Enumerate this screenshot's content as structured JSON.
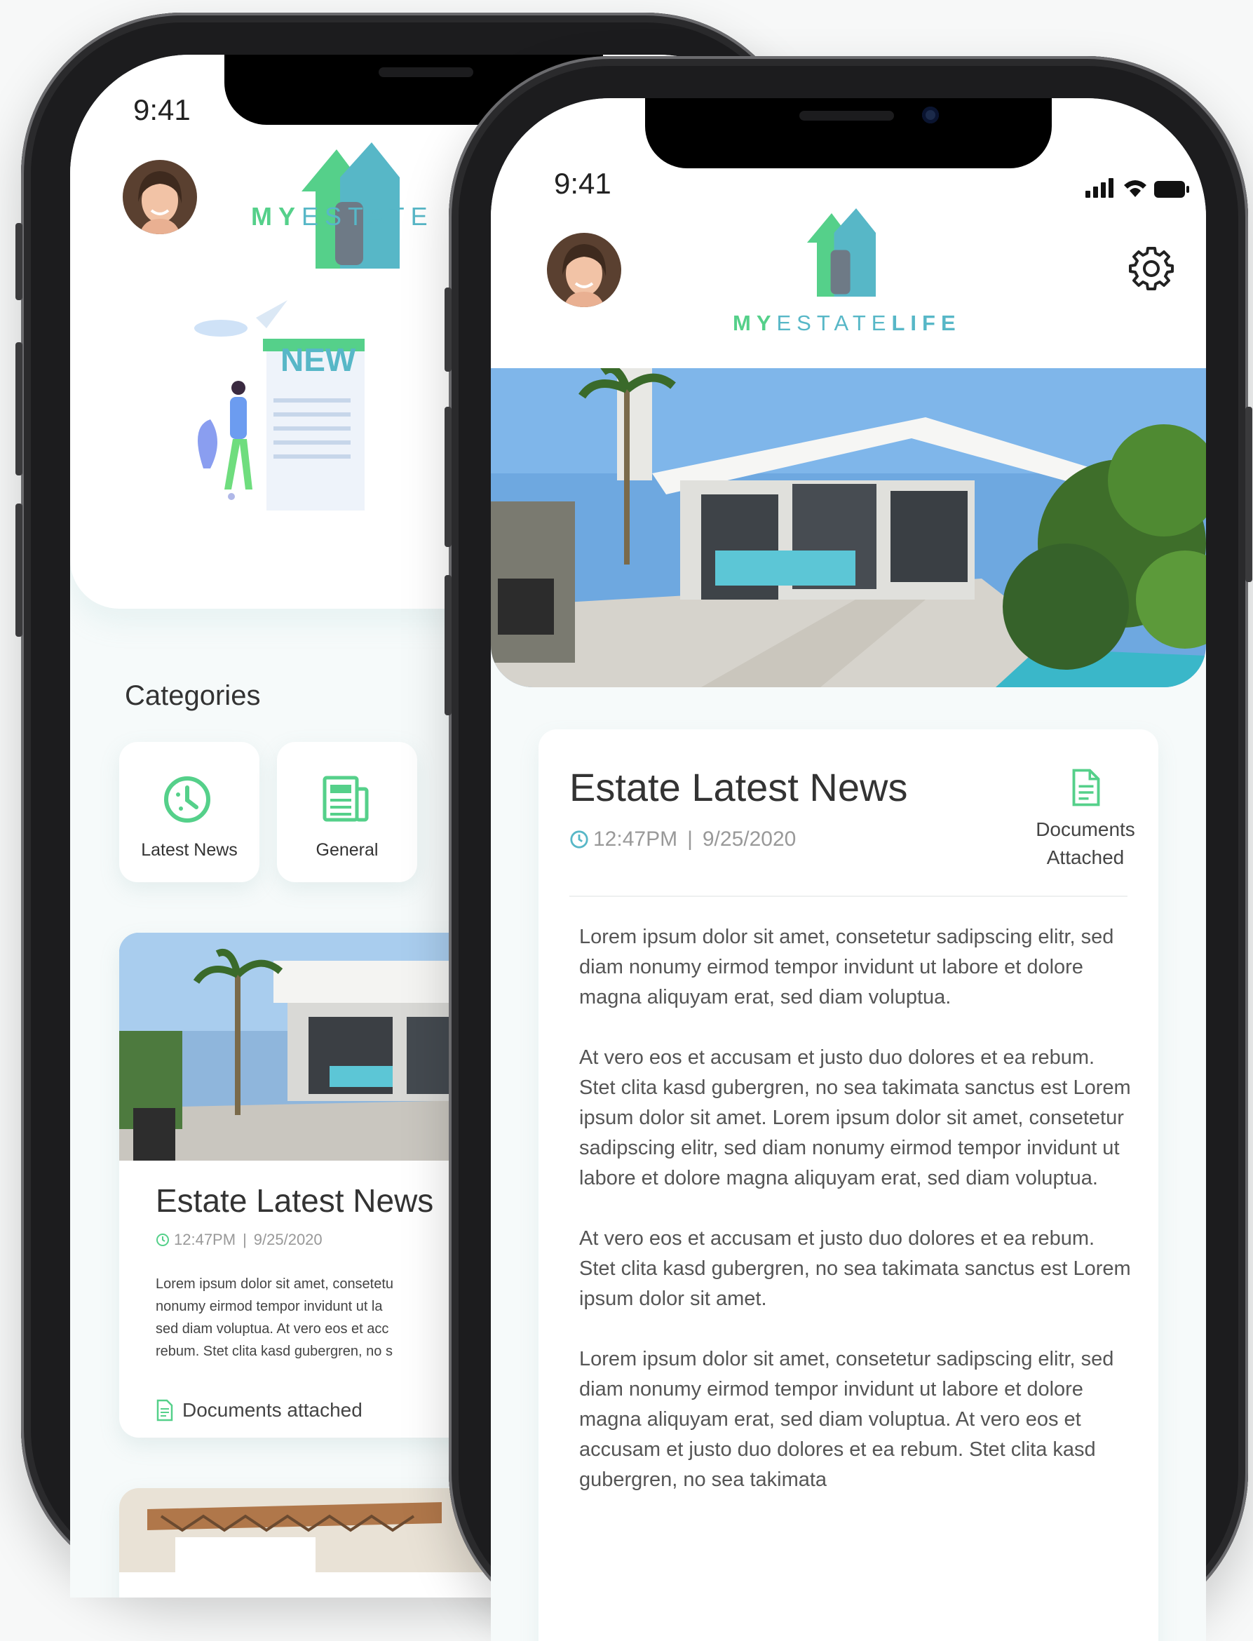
{
  "status_bar": {
    "time": "9:41"
  },
  "brand": {
    "my": "MY",
    "estate": "ESTATE",
    "life": "LIFE"
  },
  "home": {
    "categories_title": "Categories",
    "categories": [
      {
        "label": "Latest News",
        "icon": "clock-icon"
      },
      {
        "label": "General",
        "icon": "newspaper-icon"
      }
    ],
    "illustration_text": "NEW",
    "news_card": {
      "title": "Estate Latest News",
      "time": "12:47PM",
      "date": "9/25/2020",
      "excerpt_lines": [
        "Lorem ipsum dolor sit amet, consetetu",
        "nonumy eirmod tempor invidunt ut la",
        "sed diam voluptua. At vero eos et acc",
        "rebum. Stet clita kasd gubergren, no s"
      ],
      "documents_label": "Documents attached"
    }
  },
  "detail": {
    "title": "Estate Latest News",
    "time": "12:47PM",
    "date": "9/25/2020",
    "documents_label_line1": "Documents",
    "documents_label_line2": "Attached",
    "paragraphs": [
      "Lorem ipsum dolor sit amet, consetetur sadipscing elitr, sed diam nonumy eirmod tempor invidunt ut labore et dolore magna aliquyam erat, sed diam voluptua.",
      "At vero eos et accusam et justo duo dolores et ea rebum. Stet clita kasd gubergren, no sea takimata sanctus est Lorem ipsum dolor sit amet. Lorem ipsum dolor sit amet, consetetur sadipscing elitr, sed diam nonumy eirmod tempor invidunt ut labore et dolore magna aliquyam erat, sed diam voluptua.",
      "At vero eos et accusam et justo duo dolores et ea rebum. Stet clita kasd gubergren, no sea takimata sanctus est Lorem ipsum dolor sit amet.",
      "Lorem ipsum dolor sit amet, consetetur sadipscing elitr, sed diam nonumy eirmod tempor invidunt ut labore et dolore magna aliquyam erat, sed diam voluptua. At vero eos et accusam et justo duo dolores et ea rebum. Stet clita kasd gubergren, no sea takimata"
    ]
  },
  "colors": {
    "accent_green": "#55d08a",
    "accent_teal": "#57b7c7",
    "text_dark": "#333333"
  }
}
